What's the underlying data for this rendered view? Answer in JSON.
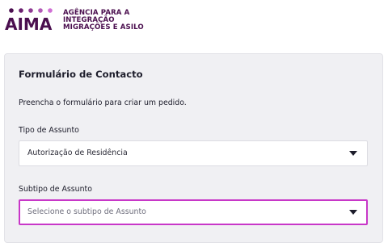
{
  "brand": {
    "name": "AIMA",
    "tagline_lines": [
      "AGÊNCIA PARA A",
      "INTEGRAÇÃO",
      "MIGRAÇÕES E ASILO"
    ],
    "colors": {
      "primary": "#4b0f4f",
      "accent": "#c837c8"
    }
  },
  "form": {
    "title": "Formulário de Contacto",
    "description": "Preencha o formulário para criar um pedido.",
    "fields": {
      "tipo": {
        "label": "Tipo de Assunto",
        "value": "Autorização de Residência",
        "icon": "chevron-down-icon"
      },
      "subtipo": {
        "label": "Subtipo de Assunto",
        "placeholder": "Selecione o subtipo de Assunto",
        "icon": "chevron-down-icon",
        "focused": true
      }
    }
  }
}
